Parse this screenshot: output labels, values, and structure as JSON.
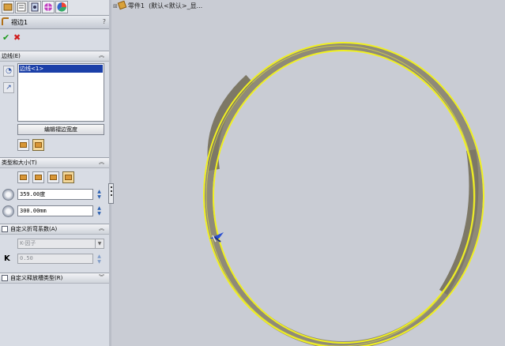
{
  "property_manager": {
    "feature_name": "褶边1",
    "help": "?",
    "edges_section": {
      "title": "边线(E)",
      "selected_edge": "边线<1>",
      "edit_width_button": "编辑褶边宽度"
    },
    "type_size_section": {
      "title": "类型和大小(T)",
      "angle_value": "359.00度",
      "radius_value": "300.00mm"
    },
    "bend_allowance_section": {
      "title": "自定义折弯系数(A)",
      "type_value": "K-因子",
      "k_label": "K",
      "k_value": "0.50"
    },
    "relief_section": {
      "title": "自定义释放槽类型(R)"
    }
  },
  "feature_tree": {
    "part_name": "零件1",
    "config_label": "(默认<默认>_显..."
  },
  "colors": {
    "selection_yellow": "#f0f020",
    "sheet_face": "#8f8a78",
    "background": "#c9ccd4"
  },
  "icons": [
    "feature-manager-icon",
    "property-manager-icon",
    "configuration-manager-icon",
    "dimxpert-icon",
    "display-manager-icon",
    "ok-check-icon",
    "cancel-x-icon",
    "edge-select-icon",
    "flip-direction-icon",
    "triad-icon"
  ]
}
